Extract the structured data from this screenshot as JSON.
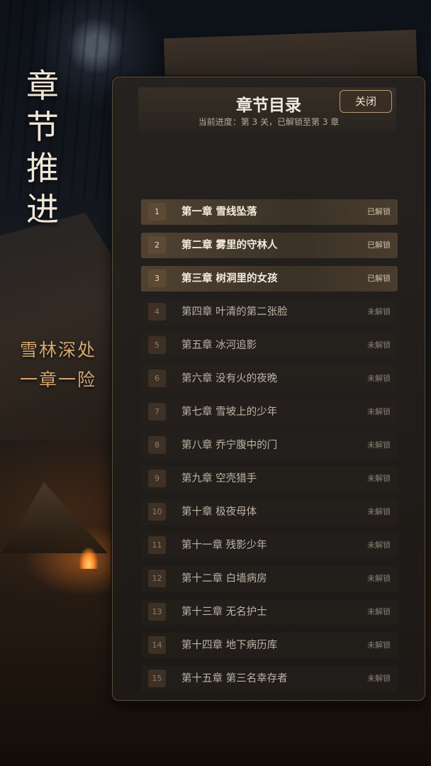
{
  "side": {
    "title_chars": [
      "章",
      "节",
      "推",
      "进"
    ],
    "subtitle_lines": [
      "雪林深处",
      "一章一险"
    ]
  },
  "panel": {
    "title": "章节目录",
    "progress_text": "当前进度：第 3 关，已解锁至第 3 章",
    "close_label": "关闭"
  },
  "chapters": [
    {
      "num": "1",
      "name": "第一章 雪线坠落",
      "status": "已解锁"
    },
    {
      "num": "2",
      "name": "第二章 雾里的守林人",
      "status": "已解锁"
    },
    {
      "num": "3",
      "name": "第三章 树洞里的女孩",
      "status": "已解锁"
    },
    {
      "num": "4",
      "name": "第四章 叶清的第二张脸",
      "status": "未解锁"
    },
    {
      "num": "5",
      "name": "第五章 冰河追影",
      "status": "未解锁"
    },
    {
      "num": "6",
      "name": "第六章 没有火的夜晚",
      "status": "未解锁"
    },
    {
      "num": "7",
      "name": "第七章 雪坡上的少年",
      "status": "未解锁"
    },
    {
      "num": "8",
      "name": "第八章 乔宁腹中的门",
      "status": "未解锁"
    },
    {
      "num": "9",
      "name": "第九章 空壳猎手",
      "status": "未解锁"
    },
    {
      "num": "10",
      "name": "第十章 极夜母体",
      "status": "未解锁"
    },
    {
      "num": "11",
      "name": "第十一章 残影少年",
      "status": "未解锁"
    },
    {
      "num": "12",
      "name": "第十二章 白墙病房",
      "status": "未解锁"
    },
    {
      "num": "13",
      "name": "第十三章 无名护士",
      "status": "未解锁"
    },
    {
      "num": "14",
      "name": "第十四章 地下病历库",
      "status": "未解锁"
    },
    {
      "num": "15",
      "name": "第十五章 第三名幸存者",
      "status": "未解锁"
    }
  ],
  "colors": {
    "accent": "#b79a72",
    "unlocked_row": "#6e583f",
    "locked_row": "#28231f",
    "subtitle": "#d6a772"
  }
}
